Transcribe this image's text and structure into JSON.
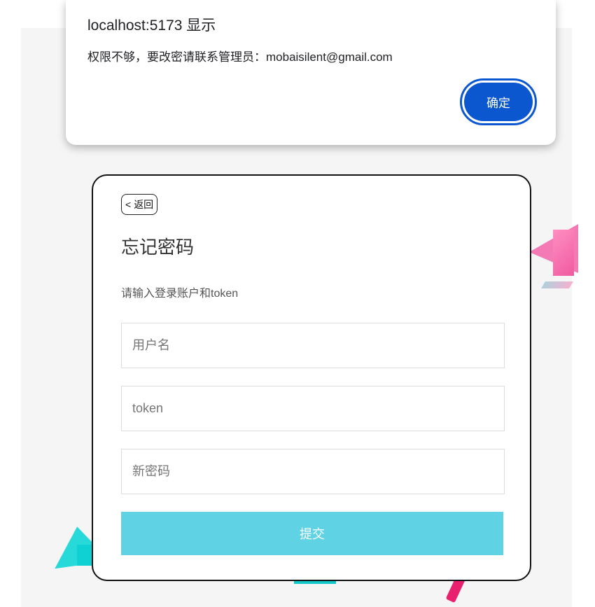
{
  "alert": {
    "title": "localhost:5173 显示",
    "message": "权限不够，要改密请联系管理员：mobaisilent@gmail.com",
    "ok_label": "确定"
  },
  "form": {
    "back_icon": "<",
    "back_label": "返回",
    "title": "忘记密码",
    "subtitle": "请输入登录账户和token",
    "username_placeholder": "用户名",
    "token_placeholder": "token",
    "new_password_placeholder": "新密码",
    "submit_label": "提交"
  },
  "colors": {
    "alert_button": "#0b57d0",
    "submit_button": "#5fd3e3",
    "page_background": "#f5f5f5"
  }
}
